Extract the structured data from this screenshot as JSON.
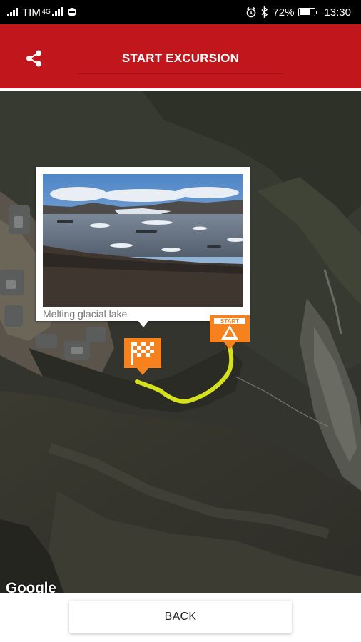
{
  "status_bar": {
    "carrier": "TIM",
    "network": "4G",
    "battery": "72%",
    "battery_level": 0.72,
    "time": "13:30",
    "icons": [
      "signal-icon",
      "data-saver-icon",
      "alarm-icon",
      "bluetooth-icon",
      "battery-icon"
    ]
  },
  "header": {
    "share_icon": "share-icon",
    "title_button": "START EXCURSION",
    "background_color": "#c1161c"
  },
  "map": {
    "attribution": "Google",
    "route_color": "#d6e11e",
    "marker_color": "#f5821f",
    "callout": {
      "caption": "Melting glacial lake",
      "image": "glacial-lake-photo"
    },
    "markers": {
      "start_label": "START",
      "finish_icon": "checkered-flag-icon"
    }
  },
  "footer": {
    "back_button": "BACK"
  }
}
